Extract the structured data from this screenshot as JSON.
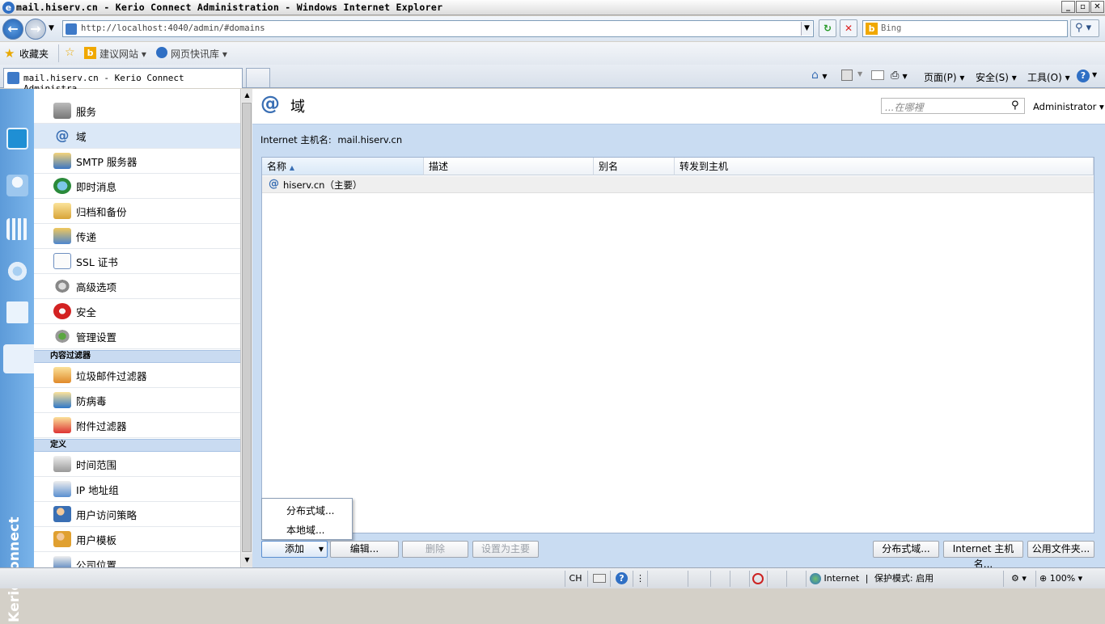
{
  "window": {
    "title": "mail.hiserv.cn - Kerio Connect Administration - Windows Internet Explorer"
  },
  "browser": {
    "address": "http://localhost:4040/admin/#domains",
    "search_placeholder": "Bing",
    "favorites": {
      "label": "收藏夹",
      "suggested": "建议网站",
      "slices": "网页快讯库"
    },
    "tab_title": "mail.hiserv.cn - Kerio Connect Administra...",
    "commands": {
      "page": "页面(P)",
      "safety": "安全(S)",
      "tools": "工具(O)"
    }
  },
  "nav": {
    "items": [
      {
        "label": "服务"
      },
      {
        "label": "域",
        "active": true
      },
      {
        "label": "SMTP 服务器"
      },
      {
        "label": "即时消息"
      },
      {
        "label": "归档和备份"
      },
      {
        "label": "传递"
      },
      {
        "label": "SSL 证书"
      },
      {
        "label": "高级选项"
      },
      {
        "label": "安全"
      },
      {
        "label": "管理设置"
      }
    ],
    "section_content_filter": "内容过滤器",
    "content_filter_items": [
      {
        "label": "垃圾邮件过滤器"
      },
      {
        "label": "防病毒"
      },
      {
        "label": "附件过滤器"
      }
    ],
    "section_definitions": "定义",
    "definition_items": [
      {
        "label": "时间范围"
      },
      {
        "label": "IP 地址组"
      },
      {
        "label": "用户访问策略"
      },
      {
        "label": "用户模板"
      },
      {
        "label": "公司位置"
      }
    ]
  },
  "brand": "KerioConnect",
  "main": {
    "title": "域",
    "search_placeholder": "...在哪裡",
    "user": "Administrator",
    "hostname_label": "Internet 主机名:",
    "hostname_value": "mail.hiserv.cn",
    "columns": [
      "名称",
      "描述",
      "别名",
      "转发到主机"
    ],
    "rows": [
      {
        "name": "hiserv.cn（主要）",
        "description": "",
        "alias": "",
        "forward": ""
      }
    ],
    "add_menu": [
      "分布式域...",
      "本地域..."
    ],
    "buttons": {
      "add": "添加",
      "edit": "编辑...",
      "delete": "删除",
      "set_primary": "设置为主要",
      "distributed": "分布式域...",
      "internet_hostname": "Internet 主机名...",
      "public_folders": "公用文件夹..."
    }
  },
  "status": {
    "ime": "CH",
    "zone": "Internet",
    "protected_mode": "保护模式: 启用",
    "zoom": "100%"
  },
  "colors": {
    "rail": "#6aa8e4",
    "main_bg": "#c9dcf2",
    "accent": "#3a6fb4"
  }
}
